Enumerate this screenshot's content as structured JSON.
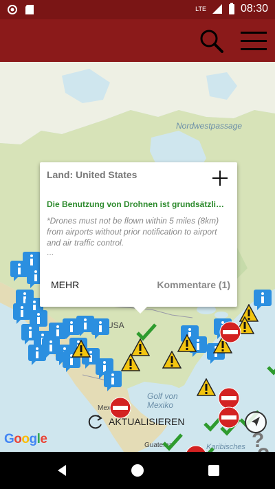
{
  "status_bar": {
    "network": "LTE",
    "time": "08:30"
  },
  "app_bar": {
    "search_icon": "search-icon",
    "menu_icon": "hamburger-menu-icon",
    "color": "#8b1a1a"
  },
  "map": {
    "labels": {
      "nordwest": "Nordwestpassage",
      "usa": "USA",
      "golf": "Golf von Mexiko",
      "mexico": "Mexiko",
      "karib": "Karibisches",
      "guate": "Guatema"
    },
    "attribution": "Google"
  },
  "info_window": {
    "title": "Land: United States",
    "headline": "Die Benutzung von Drohnen ist grundsätzli…",
    "body": "*Drones must not be flown within 5 miles (8km) from airports without prior notification to airport and air traffic control.",
    "ellipsis": "...",
    "more_label": "MEHR",
    "comments_label": "Kommentare (1)"
  },
  "refresh_label": "AKTUALISIEREN",
  "colors": {
    "info_marker": "#2b8fe0",
    "warning": "#f2c40f",
    "ok": "#2e9b2e",
    "no": "#d32222"
  }
}
